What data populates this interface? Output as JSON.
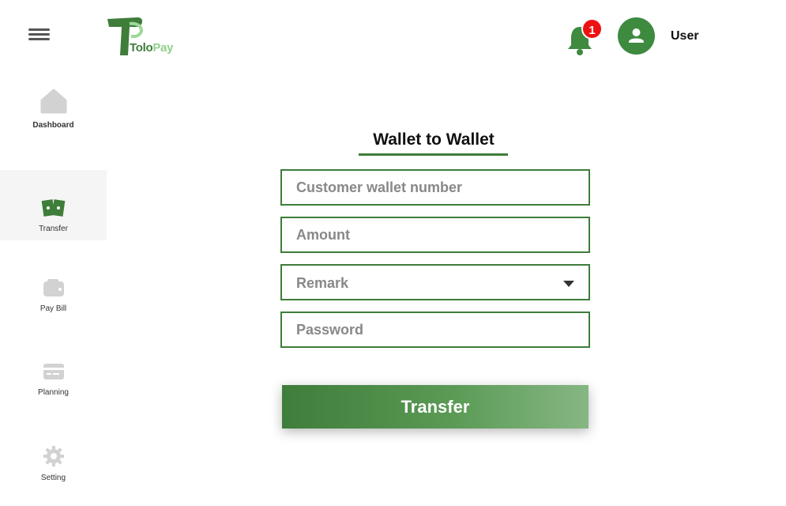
{
  "header": {
    "menu_icon": "hamburger-icon",
    "logo": {
      "part1": "Tolo",
      "part2": "Pay"
    },
    "notification_count": "1",
    "user_name": "User"
  },
  "sidebar": {
    "items": [
      {
        "label": "Dashboard",
        "icon": "home-icon",
        "active": false
      },
      {
        "label": "Transfer",
        "icon": "money-icon",
        "active": true
      },
      {
        "label": "Pay Bill",
        "icon": "wallet-icon",
        "active": false
      },
      {
        "label": "Planning",
        "icon": "card-icon",
        "active": false
      },
      {
        "label": "Setting",
        "icon": "gear-icon",
        "active": false
      }
    ]
  },
  "form": {
    "title": "Wallet to Wallet",
    "wallet_placeholder": "Customer wallet number",
    "amount_placeholder": "Amount",
    "remark_selected": "Remark",
    "password_placeholder": "Password",
    "submit_label": "Transfer"
  },
  "colors": {
    "accent": "#3e7d3a",
    "badge": "#ee1111",
    "sidebar_active_bg": "#f5f5f5"
  }
}
